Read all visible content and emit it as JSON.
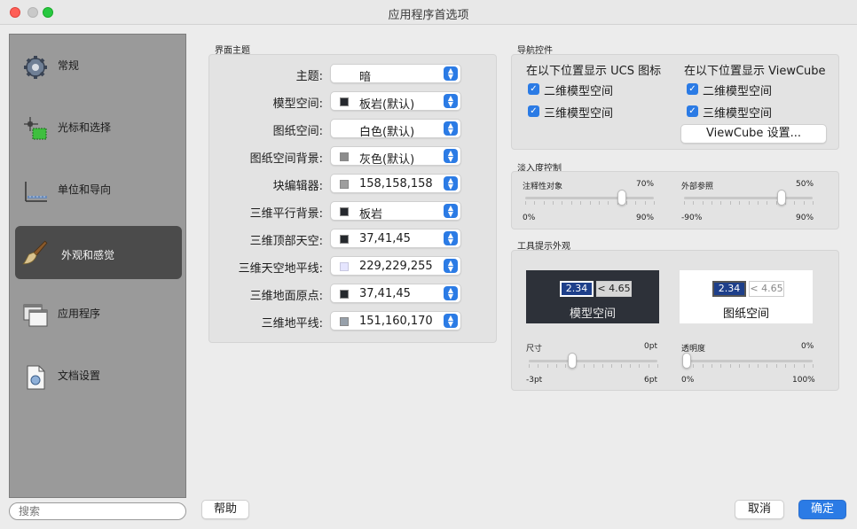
{
  "window": {
    "title": "应用程序首选项"
  },
  "sidebar": {
    "items": [
      {
        "label": "常规",
        "icon": "gear-icon"
      },
      {
        "label": "光标和选择",
        "icon": "cursor-select-icon"
      },
      {
        "label": "单位和导向",
        "icon": "units-guides-icon"
      },
      {
        "label": "外观和感觉",
        "icon": "brush-icon",
        "active": true
      },
      {
        "label": "应用程序",
        "icon": "windows-icon"
      },
      {
        "label": "文档设置",
        "icon": "document-icon"
      }
    ],
    "search_placeholder": "搜索"
  },
  "theme": {
    "group_title": "界面主题",
    "rows": [
      {
        "label": "主题:",
        "value": "暗",
        "swatch": null
      },
      {
        "label": "模型空间:",
        "value": "板岩(默认)",
        "swatch": "#26292e"
      },
      {
        "label": "图纸空间:",
        "value": "白色(默认)",
        "swatch": "#ffffff"
      },
      {
        "label": "图纸空间背景:",
        "value": "灰色(默认)",
        "swatch": "#8c8c8c"
      },
      {
        "label": "块编辑器:",
        "value": "158,158,158",
        "swatch": "#9e9e9e"
      },
      {
        "label": "三维平行背景:",
        "value": "板岩",
        "swatch": "#26292e"
      },
      {
        "label": "三维顶部天空:",
        "value": "37,41,45",
        "swatch": "#25292d"
      },
      {
        "label": "三维天空地平线:",
        "value": "229,229,255",
        "swatch": "#e5e5ff"
      },
      {
        "label": "三维地面原点:",
        "value": "37,41,45",
        "swatch": "#25292d"
      },
      {
        "label": "三维地平线:",
        "value": "151,160,170",
        "swatch": "#97a0aa"
      }
    ]
  },
  "nav": {
    "group_title": "导航控件",
    "ucs_heading": "在以下位置显示 UCS 图标",
    "viewcube_heading": "在以下位置显示 ViewCube",
    "ucs_2d": "二维模型空间",
    "ucs_3d": "三维模型空间",
    "vc_2d": "二维模型空间",
    "vc_3d": "三维模型空间",
    "viewcube_settings": "ViewCube 设置..."
  },
  "fade": {
    "group_title": "淡入度控制",
    "annotative": {
      "label": "注释性对象",
      "value": "70%",
      "min": "0%",
      "max": "90%",
      "level": 70
    },
    "xref": {
      "label": "外部参照",
      "value": "50%",
      "min": "-90%",
      "max": "90%",
      "level": 50
    }
  },
  "tooltip": {
    "group_title": "工具提示外观",
    "model_caption": "模型空间",
    "paper_caption": "图纸空间",
    "sample_value": "2.34",
    "sample_tip": "< 4.65",
    "size": {
      "label": "尺寸",
      "value": "0pt",
      "min": "-3pt",
      "max": "6pt",
      "level": 0
    },
    "transparency": {
      "label": "透明度",
      "value": "0%",
      "min": "0%",
      "max": "100%",
      "level": 0
    }
  },
  "footer": {
    "help": "帮助",
    "cancel": "取消",
    "ok": "确定"
  },
  "colors": {
    "accent": "#2b7be5",
    "sidebar_bg": "#9a9a9a",
    "active_item": "#4b4b4b"
  }
}
